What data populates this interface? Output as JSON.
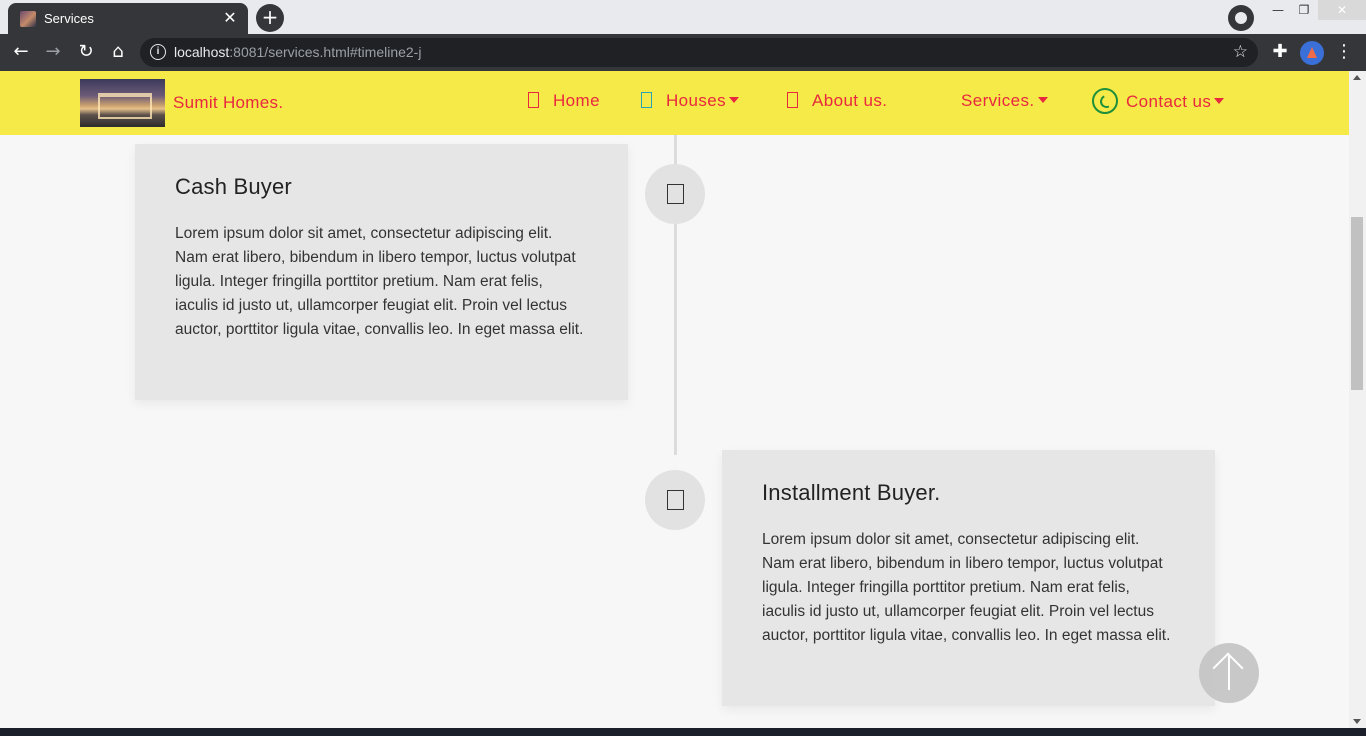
{
  "browser": {
    "tab_title": "Services",
    "tab_close": "✕",
    "new_tab": "+",
    "url_host": "localhost",
    "url_rest": ":8081/services.html#timeline2-j",
    "window_min": "—",
    "window_max": "❐",
    "window_close": "✕"
  },
  "navbar": {
    "brand": "Sumit Homes.",
    "items": [
      {
        "label": "Home"
      },
      {
        "label": "Houses"
      },
      {
        "label": "About us."
      },
      {
        "label": "Services."
      },
      {
        "label": "Contact us"
      }
    ]
  },
  "timeline": [
    {
      "title": "Cash Buyer",
      "text": "Lorem ipsum dolor sit amet, consectetur adipiscing elit. Nam erat libero, bibendum in libero tempor, luctus volutpat ligula. Integer fringilla porttitor pretium. Nam erat felis, iaculis id justo ut, ullamcorper feugiat elit. Proin vel lectus auctor, porttitor ligula vitae, convallis leo. In eget massa elit."
    },
    {
      "title": "Installment Buyer.",
      "text": "Lorem ipsum dolor sit amet, consectetur adipiscing elit. Nam erat libero, bibendum in libero tempor, luctus volutpat ligula. Integer fringilla porttitor pretium. Nam erat felis, iaculis id justo ut, ullamcorper feugiat elit. Proin vel lectus auctor, porttitor ligula vitae, convallis leo. In eget massa elit."
    }
  ],
  "colors": {
    "navbar_bg": "#f5ea48",
    "nav_text": "#e8283f",
    "card_bg": "#e6e6e6",
    "page_bg": "#f7f7f7"
  },
  "icons": {
    "back": "arrow-left-icon",
    "forward": "arrow-right-icon",
    "reload": "reload-icon",
    "home": "home-icon",
    "info": "info-icon",
    "bookmark": "star-icon",
    "extensions": "puzzle-icon",
    "menu": "kebab-menu-icon",
    "contact": "whatsapp-icon",
    "back_to_top": "arrow-up-icon"
  }
}
